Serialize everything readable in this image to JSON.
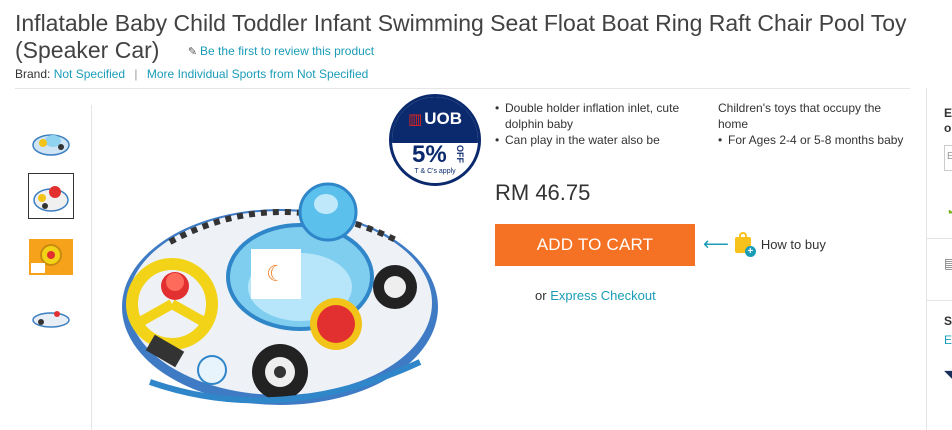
{
  "product": {
    "title": "Inflatable Baby Child Toddler Infant Swimming Seat Float Boat Ring Raft Chair Pool Toy (Speaker Car)",
    "title_line1": "Inflatable Baby Child Toddler Infant Swimming Seat Float Boat Ring Raft Chair Pool Toy",
    "title_line2": "(Speaker Car)",
    "review_link": "Be the first to review this product",
    "brand_label": "Brand:",
    "brand_value": "Not Specified",
    "more_link": "More Individual Sports from Not Specified",
    "price": "RM 46.75"
  },
  "features": {
    "col1": [
      "Double holder inflation inlet, cute dolphin baby",
      "Can play in the water also be"
    ],
    "col2_first_text": "Children's toys that occupy the home",
    "col2": [
      "For Ages 2-4 or 5-8 months baby"
    ]
  },
  "actions": {
    "add_to_cart": "ADD TO CART",
    "how_to_buy": "How to buy",
    "express_prefix": "or",
    "express_link": "Express Checkout"
  },
  "badge": {
    "brand": "UOB",
    "percent": "5%",
    "off": "OFF",
    "terms": "T & C's apply"
  },
  "thumbnails": [
    {
      "name": "thumb-1",
      "active": false
    },
    {
      "name": "thumb-2",
      "active": true
    },
    {
      "name": "thumb-3",
      "active": false
    },
    {
      "name": "thumb-4",
      "active": false
    }
  ],
  "sidebar": {
    "letter_e": "E",
    "letter_o": "o",
    "letter_s": "S",
    "letter_e2": "E",
    "box_letter": "E"
  },
  "colors": {
    "accent": "#f57224",
    "link": "#1a9cb7",
    "uob_blue": "#0b2a6e"
  },
  "icons": [
    "pencil-icon",
    "loading-spinner-icon",
    "arrow-left-icon",
    "shopping-bag-plus-icon"
  ]
}
